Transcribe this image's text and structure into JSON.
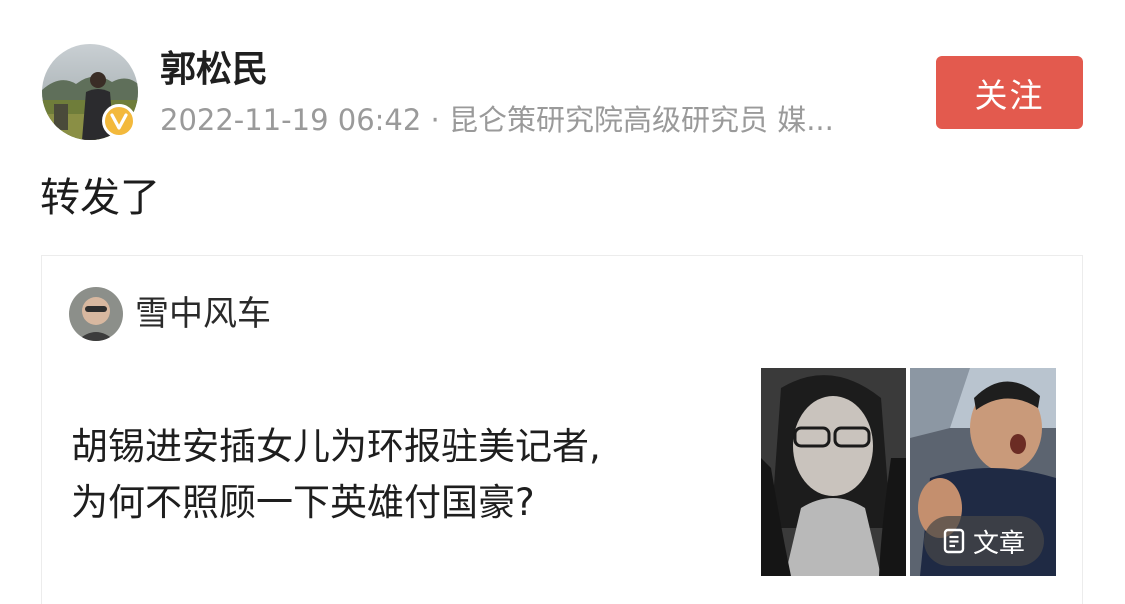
{
  "post": {
    "author_name": "郭松民",
    "meta": "2022-11-19 06:42 · 昆仑策研究院高级研究员 媒...",
    "follow_label": "关注",
    "body_text": "转发了"
  },
  "quoted": {
    "author_name": "雪中风车",
    "title_line_1": "胡锡进安插女儿为环报驻美记者,",
    "title_line_2": "为何不照顾一下英雄付国豪?",
    "badge_label": "文章",
    "badge_icon": "article-icon"
  },
  "colors": {
    "follow_button": "#e35a4e",
    "meta_text": "#9a9a9a",
    "verified_badge": "#f3b93c"
  }
}
